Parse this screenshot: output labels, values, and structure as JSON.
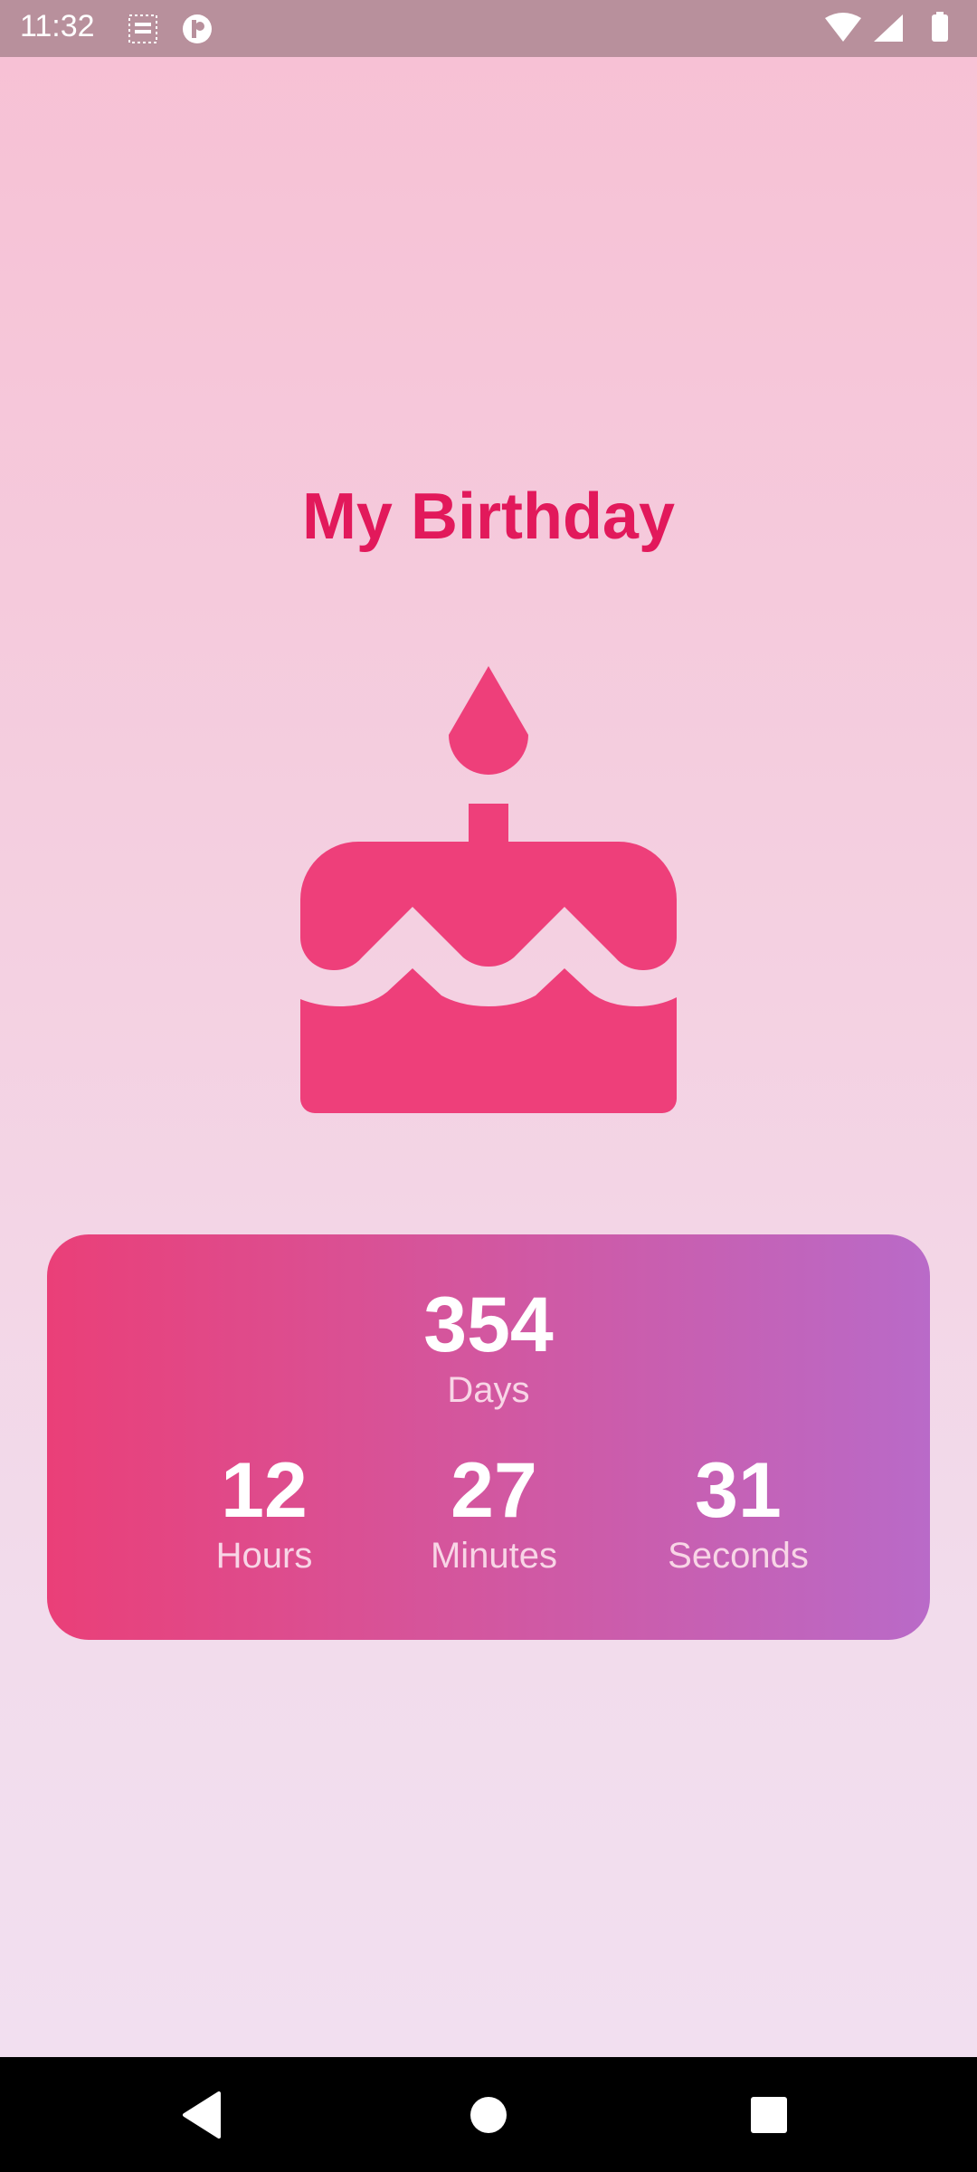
{
  "status_bar": {
    "time": "11:32",
    "icons": [
      "birthday-notification-icon",
      "app-notification-icon",
      "wifi-icon",
      "cellular-signal-icon",
      "battery-icon"
    ]
  },
  "main": {
    "title": "My Birthday",
    "icon": "cake-icon",
    "accent_color": "#e2195b",
    "icon_color": "#ee3f7a"
  },
  "countdown": {
    "days": {
      "value": "354",
      "label": "Days"
    },
    "hours": {
      "value": "12",
      "label": "Hours"
    },
    "minutes": {
      "value": "27",
      "label": "Minutes"
    },
    "seconds": {
      "value": "31",
      "label": "Seconds"
    },
    "gradient_start": "#ea3f78",
    "gradient_end": "#b96ac8"
  },
  "nav_bar": {
    "buttons": [
      "back-icon",
      "home-icon",
      "recents-icon"
    ]
  }
}
